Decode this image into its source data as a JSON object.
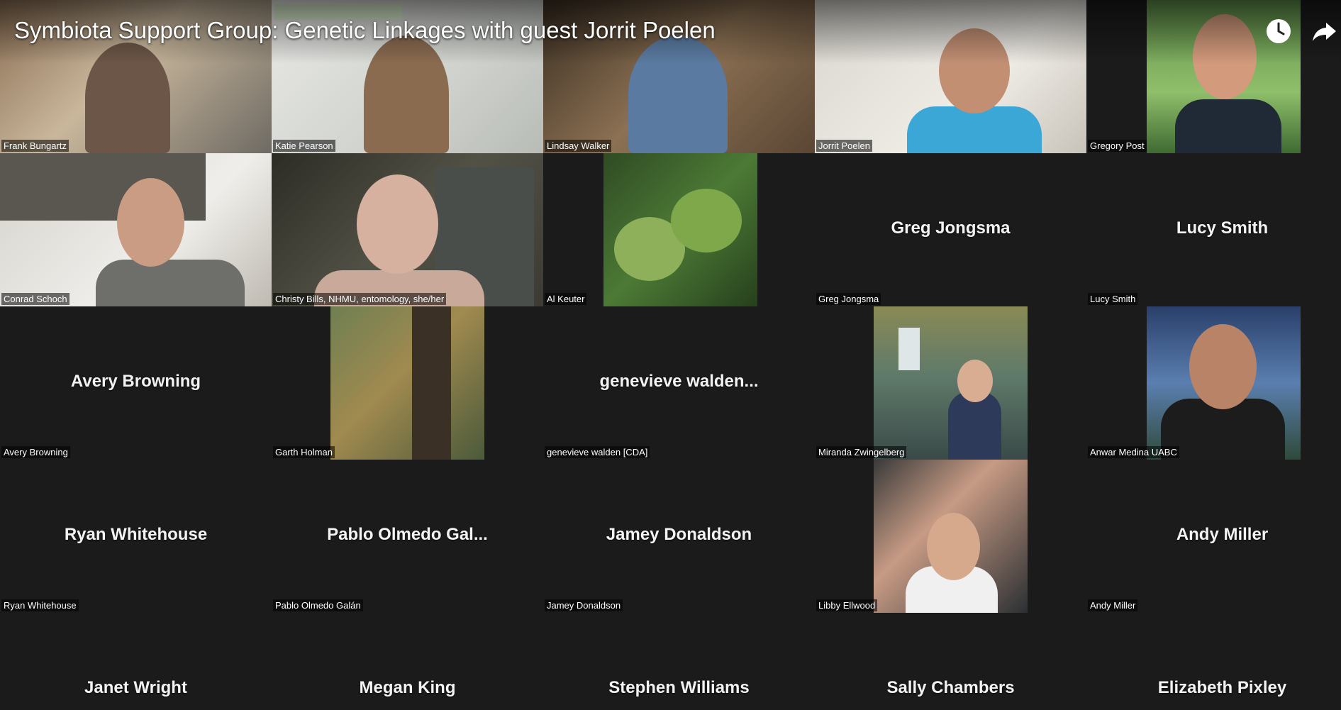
{
  "video_title": "Symbiota Support Group: Genetic Linkages with guest Jorrit Poelen",
  "icons": {
    "watch_later": "clock-icon",
    "share": "share-arrow-icon"
  },
  "colors": {
    "background": "#1b1b1b",
    "name_text": "#f3f3f3"
  },
  "participants": [
    {
      "label": "Frank Bungartz"
    },
    {
      "label": "Katie Pearson"
    },
    {
      "label": "Lindsay Walker"
    },
    {
      "label": "Jorrit Poelen"
    },
    {
      "label": "Gregory Post"
    },
    {
      "label": "Conrad Schoch"
    },
    {
      "label": "Christy Bills, NHMU, entomology, she/her"
    },
    {
      "label": "Al Keuter"
    },
    {
      "label": "Greg Jongsma",
      "display": "Greg Jongsma"
    },
    {
      "label": "Lucy Smith",
      "display": "Lucy Smith"
    },
    {
      "label": "Avery Browning",
      "display": "Avery Browning"
    },
    {
      "label": "Garth Holman"
    },
    {
      "label": "genevieve walden [CDA]",
      "display": "genevieve walden..."
    },
    {
      "label": "Miranda Zwingelberg"
    },
    {
      "label": "Anwar Medina UABC"
    },
    {
      "label": "Ryan Whitehouse",
      "display": "Ryan Whitehouse"
    },
    {
      "label": "Pablo Olmedo Galán",
      "display": "Pablo Olmedo Gal..."
    },
    {
      "label": "Jamey Donaldson",
      "display": "Jamey Donaldson"
    },
    {
      "label": "Libby Ellwood"
    },
    {
      "label": "Andy Miller",
      "display": "Andy Miller"
    },
    {
      "display": "Janet Wright"
    },
    {
      "display": "Megan King"
    },
    {
      "display": "Stephen Williams"
    },
    {
      "display": "Sally Chambers"
    },
    {
      "display": "Elizabeth Pixley"
    }
  ]
}
